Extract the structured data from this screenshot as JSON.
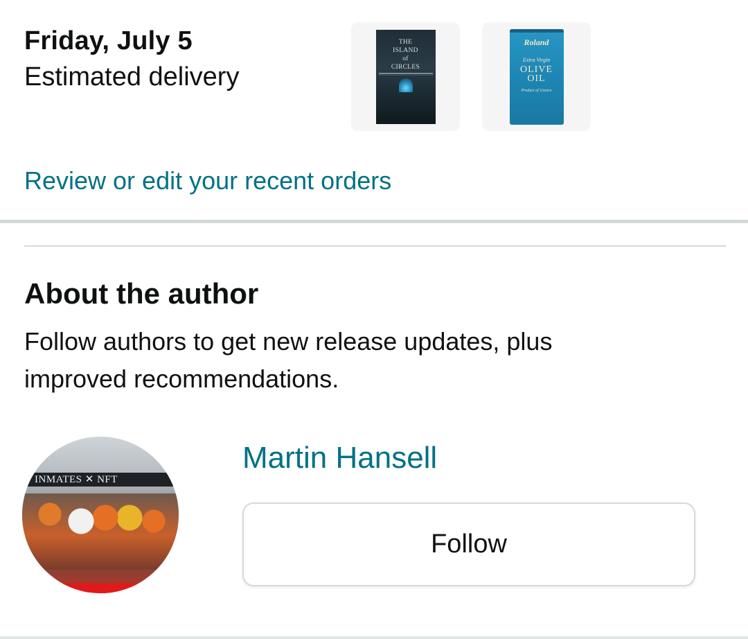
{
  "delivery": {
    "date": "Friday, July 5",
    "label": "Estimated delivery",
    "items": [
      {
        "type": "book",
        "title": "ISLAND\nof\nCIRCLES",
        "title_prefix": "THE",
        "icon": "book-cover-image"
      },
      {
        "type": "product",
        "brand": "Roland",
        "sub": "Extra Virgin",
        "name": "OLIVE\nOIL",
        "origin": "Product of Greece",
        "icon": "olive-oil-can-image"
      }
    ],
    "review_link": "Review or edit your recent orders"
  },
  "about_author": {
    "title": "About the author",
    "description": "Follow authors to get new release updates, plus improved recommendations.",
    "avatar_banner": "INMATES  ✕  NFT",
    "author_name": "Martin Hansell",
    "follow_label": "Follow"
  },
  "colors": {
    "link": "#007185",
    "text": "#0f1111",
    "divider": "#d5d9d9"
  }
}
